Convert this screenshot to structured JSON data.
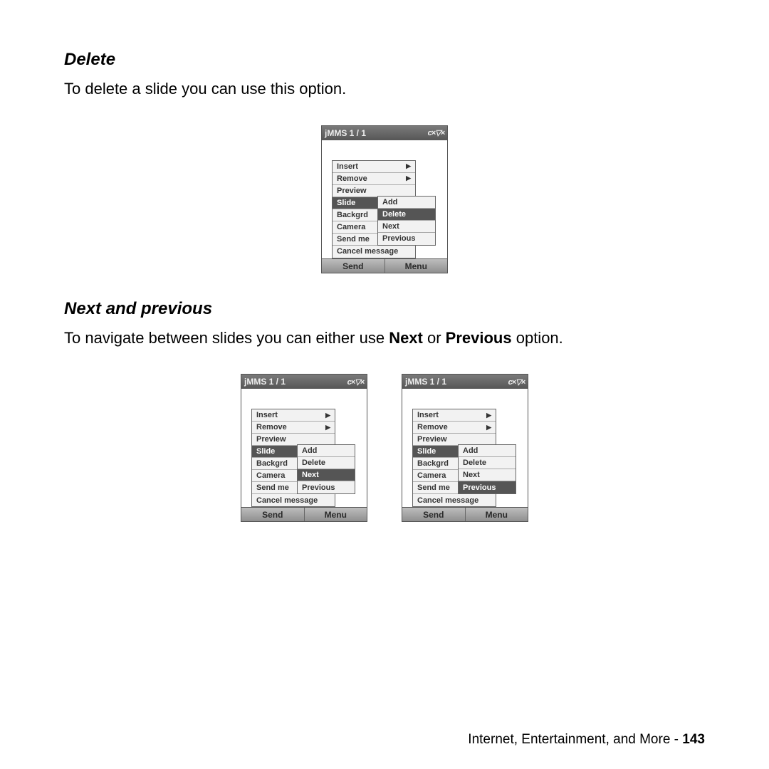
{
  "section1": {
    "heading": "Delete",
    "body": "To delete a slide you can use this option."
  },
  "section2": {
    "heading": "Next and previous",
    "body_pre": "To navigate between slides you can either use ",
    "body_b1": "Next",
    "body_mid": " or ",
    "body_b2": "Previous",
    "body_post": " option."
  },
  "phone_common": {
    "title": "jMMS 1 / 1",
    "main_menu": [
      "Insert",
      "Remove",
      "Preview",
      "Slide",
      "Backgrd",
      "Camera",
      "Send me",
      "Cancel message"
    ],
    "main_arrow_indices": [
      0,
      1
    ],
    "main_selected_index": 3,
    "sub_menu": [
      "Add",
      "Delete",
      "Next",
      "Previous"
    ],
    "softkey_left": "Send",
    "softkey_right": "Menu",
    "status_icons": "c×▽×"
  },
  "phones": [
    {
      "sub_selected_index": 1
    },
    {
      "sub_selected_index": 2
    },
    {
      "sub_selected_index": 3
    }
  ],
  "footer": {
    "text": "Internet, Entertainment, and More - ",
    "page": "143"
  }
}
